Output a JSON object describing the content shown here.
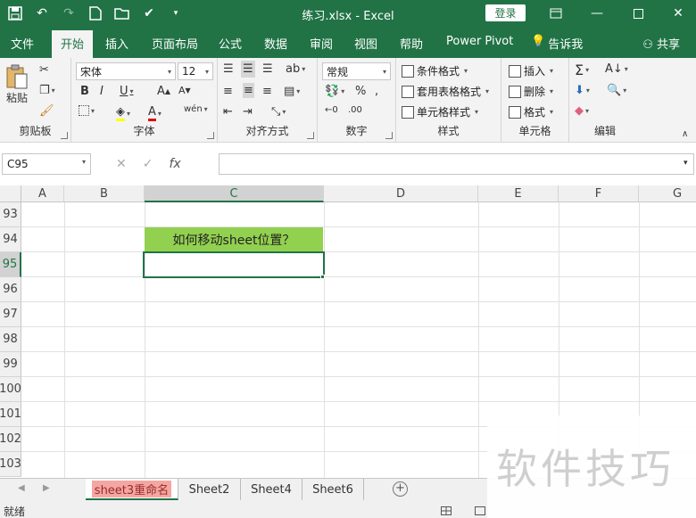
{
  "titlebar": {
    "title": "练习.xlsx  -  Excel",
    "login": "登录",
    "colors": {
      "bg": "#217346"
    }
  },
  "tabs": [
    "文件",
    "开始",
    "插入",
    "页面布局",
    "公式",
    "数据",
    "审阅",
    "视图",
    "帮助",
    "Power Pivot",
    "告诉我"
  ],
  "share": "共享",
  "ribbon": {
    "clipboard": {
      "label": "剪贴板",
      "paste": "粘贴"
    },
    "font": {
      "label": "字体",
      "name": "宋体",
      "size": "12"
    },
    "alignment": {
      "label": "对齐方式"
    },
    "number": {
      "label": "数字",
      "format": "常规"
    },
    "styles": {
      "label": "样式",
      "conditional": "条件格式",
      "table": "套用表格格式",
      "cell_styles": "单元格样式"
    },
    "cells": {
      "label": "单元格",
      "insert": "插入",
      "delete": "删除",
      "format": "格式"
    },
    "editing": {
      "label": "编辑"
    }
  },
  "formula_bar": {
    "name_box": "C95",
    "fx": "fx",
    "formula": ""
  },
  "columns": [
    "A",
    "B",
    "C",
    "D",
    "E",
    "F",
    "G"
  ],
  "rows": [
    "93",
    "94",
    "95",
    "96",
    "97",
    "98",
    "99",
    "100",
    "101",
    "102",
    "103"
  ],
  "cells": {
    "C94": "如何移动sheet位置？"
  },
  "selection": {
    "column": "C",
    "row": "95",
    "color": "#217346"
  },
  "sheets": [
    "sheet3重命名",
    "Sheet2",
    "Sheet4",
    "Sheet6"
  ],
  "active_sheet": "sheet3重命名",
  "status": {
    "text": "就绪"
  },
  "watermark": "软件技巧"
}
